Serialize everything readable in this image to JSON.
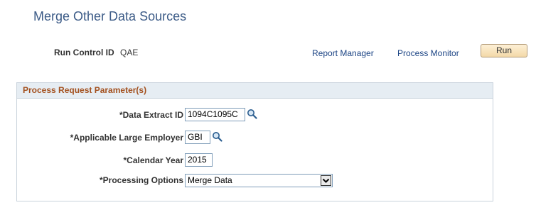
{
  "header": {
    "title": "Merge Other Data Sources",
    "run_control_label": "Run Control ID",
    "run_control_value": "QAE",
    "report_manager_link": "Report Manager",
    "process_monitor_link": "Process Monitor",
    "run_button": "Run"
  },
  "params": {
    "group_title": "Process Request Parameter(s)",
    "data_extract_label": "*Data Extract ID",
    "data_extract_value": "1094C1095C",
    "employer_label": "*Applicable Large Employer",
    "employer_value": "GBI",
    "year_label": "*Calendar Year",
    "year_value": "2015",
    "processing_label": "*Processing Options",
    "processing_value": "Merge Data"
  },
  "icons": {
    "lookup": "magnifying-glass-icon",
    "dropdown": "chevron-down-icon"
  },
  "colors": {
    "title": "#3c5b87",
    "link": "#1c4484",
    "group_title": "#a3501e",
    "group_header_bg": "#e6edf3",
    "button_bg": "#f3d9a8"
  }
}
